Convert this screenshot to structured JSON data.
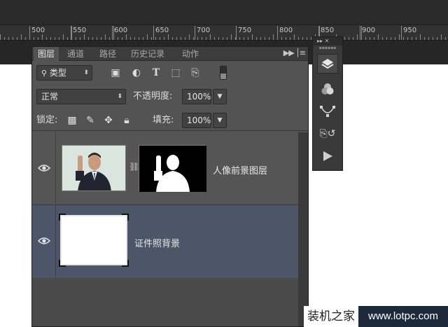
{
  "ruler": {
    "labels": [
      "500",
      "550",
      "600",
      "650",
      "700",
      "750",
      "800",
      "850",
      "900",
      "950"
    ]
  },
  "panel": {
    "tabs": [
      {
        "label": "图层",
        "active": true
      },
      {
        "label": "通道",
        "active": false
      },
      {
        "label": "路径",
        "active": false
      },
      {
        "label": "历史记录",
        "active": false
      },
      {
        "label": "动作",
        "active": false
      }
    ],
    "filter": {
      "value": "类型"
    },
    "blend_mode": {
      "value": "正常"
    },
    "opacity": {
      "label": "不透明度:",
      "value": "100%"
    },
    "lock": {
      "label": "锁定:"
    },
    "fill": {
      "label": "填充:",
      "value": "100%"
    },
    "layers": [
      {
        "name": "人像前景图层",
        "visible": true,
        "selected": false
      },
      {
        "name": "证件照背景",
        "visible": true,
        "selected": true
      }
    ]
  },
  "side_panel": {
    "header": "▸▸  ✕"
  },
  "watermark": {
    "left": "装机之家",
    "right": "www.lotpc.com"
  }
}
